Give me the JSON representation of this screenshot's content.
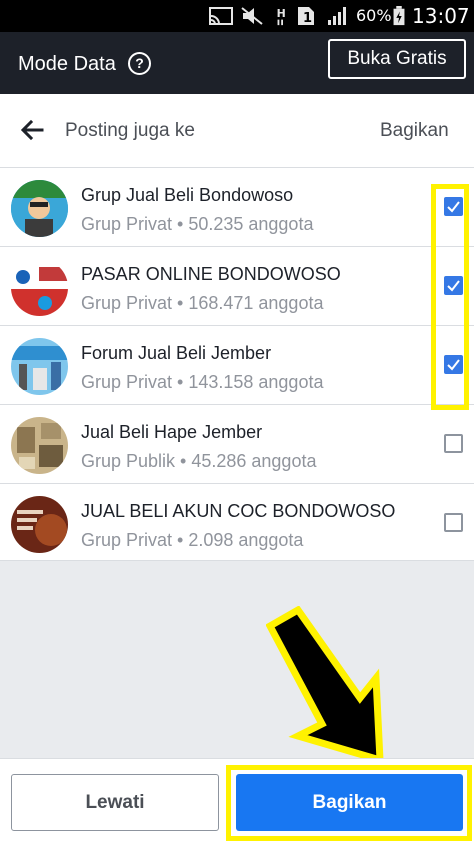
{
  "status_bar": {
    "battery_percent": "60%",
    "time": "13:07",
    "icons": [
      "cast-icon",
      "mute-icon",
      "data-h-icon",
      "sim-icon",
      "signal-icon",
      "battery-charging-icon"
    ]
  },
  "mode_bar": {
    "title": "Mode Data",
    "help_icon": "?",
    "free_button": "Buka Gratis"
  },
  "header": {
    "title": "Posting juga ke",
    "action": "Bagikan"
  },
  "groups": [
    {
      "name": "Grup Jual Beli Bondowoso",
      "meta": "Grup Privat • 50.235 anggota",
      "checked": true,
      "avatar_color": "#3aa7d8"
    },
    {
      "name": "PASAR ONLINE BONDOWOSO",
      "meta": "Grup Privat • 168.471 anggota",
      "checked": true,
      "avatar_color": "#d0312d"
    },
    {
      "name": "Forum Jual Beli Jember",
      "meta": "Grup Privat • 143.158 anggota",
      "checked": true,
      "avatar_color": "#2f8fd0"
    },
    {
      "name": "Jual Beli Hape Jember",
      "meta": "Grup Publik • 45.286 anggota",
      "checked": false,
      "avatar_color": "#b8a57e"
    },
    {
      "name": "JUAL BELI AKUN COC BONDOWOSO",
      "meta": "Grup Privat • 2.098 anggota",
      "checked": false,
      "avatar_color": "#6a2616"
    }
  ],
  "footer": {
    "skip_label": "Lewati",
    "share_label": "Bagikan"
  },
  "colors": {
    "accent": "#1877f2",
    "checkbox": "#3578e5",
    "highlight": "#fff200",
    "mode_bar": "#1d2129"
  }
}
